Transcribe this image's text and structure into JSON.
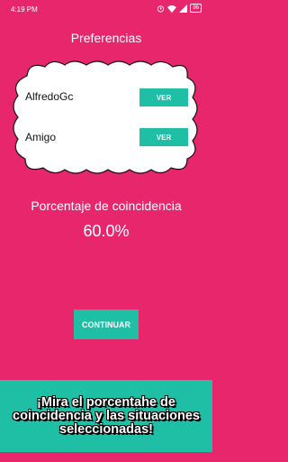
{
  "status": {
    "time": "4:19 PM",
    "battery": "96"
  },
  "header": {
    "title": "Preferencias"
  },
  "matches": [
    {
      "name": "AlfredoGc",
      "button": "VER"
    },
    {
      "name": "Amigo",
      "button": "VER"
    }
  ],
  "result": {
    "label": "Porcentaje de coincidencia",
    "value": "60.0%"
  },
  "actions": {
    "continue_label": "CONTINUAR"
  },
  "banner": {
    "text": "¡Mira el porcentahe de coincidencia y las situaciones seleccionadas!"
  },
  "colors": {
    "background": "#e8266b",
    "accent": "#1fbfa5",
    "cloud": "#ffffff"
  },
  "icons": [
    "alarm-icon",
    "wifi-icon",
    "signal-icon",
    "battery-icon"
  ]
}
